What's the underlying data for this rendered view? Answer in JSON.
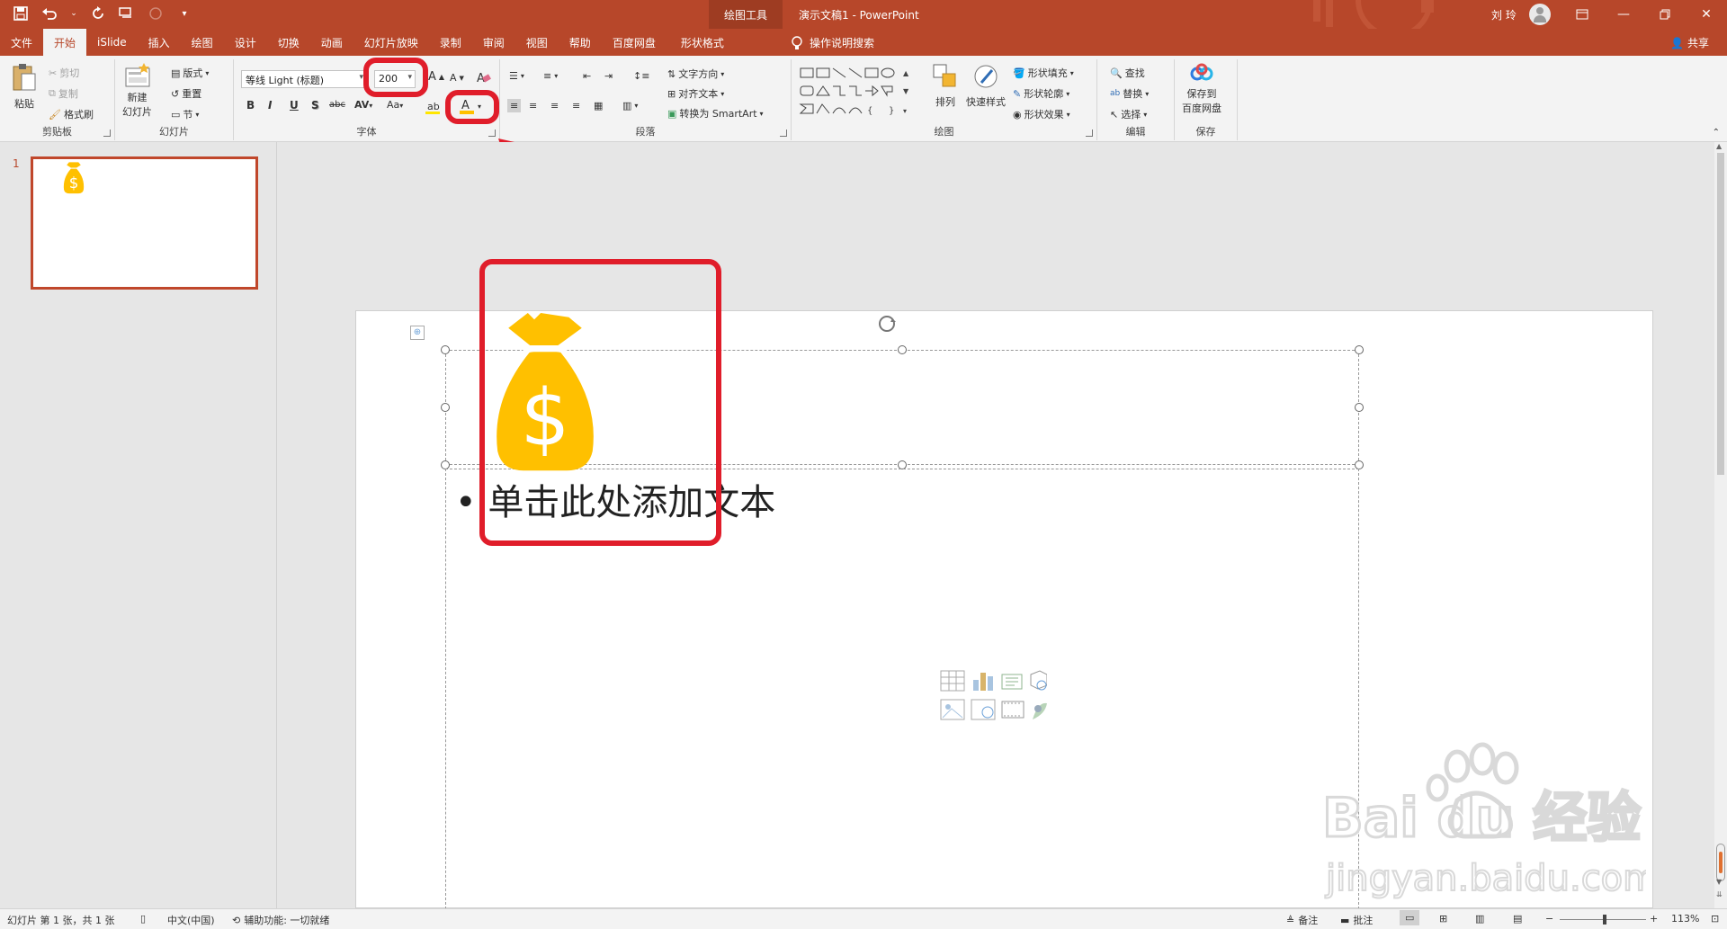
{
  "titlebar": {
    "context_group": "绘图工具",
    "doc_title": "演示文稿1  -  PowerPoint",
    "user_name": "刘 玲",
    "qat_icons": [
      "save-icon",
      "undo-icon",
      "redo-icon",
      "format-painter-icon",
      "customize-icon"
    ]
  },
  "tabs": [
    "文件",
    "开始",
    "iSlide",
    "插入",
    "绘图",
    "设计",
    "切换",
    "动画",
    "幻灯片放映",
    "录制",
    "审阅",
    "视图",
    "帮助",
    "百度网盘",
    "形状格式"
  ],
  "active_tab": "开始",
  "tell_me": "操作说明搜索",
  "share": "共享",
  "ribbon": {
    "clipboard": {
      "paste": "粘贴",
      "cut": "剪切",
      "copy": "复制",
      "format_painter": "格式刷",
      "label": "剪贴板"
    },
    "slides": {
      "new_slide_line1": "新建",
      "new_slide_line2": "幻灯片",
      "layout": "版式",
      "reset": "重置",
      "section": "节",
      "label": "幻灯片"
    },
    "font": {
      "font_name": "等线 Light (标题)",
      "font_size": "200",
      "bold": "B",
      "italic": "I",
      "underline": "U",
      "shadow": "S",
      "strike": "abc",
      "spacing": "AV",
      "case": "Aa",
      "font_color_letter": "A",
      "label": "字体"
    },
    "paragraph": {
      "text_direction": "文字方向",
      "align_text": "对齐文本",
      "smartart": "转换为 SmartArt",
      "label": "段落"
    },
    "drawing": {
      "arrange": "排列",
      "quick_styles": "快速样式",
      "shape_fill": "形状填充",
      "shape_outline": "形状轮廓",
      "shape_effects": "形状效果",
      "label": "绘图"
    },
    "editing": {
      "find": "查找",
      "replace": "替换",
      "select": "选择",
      "label": "编辑"
    },
    "save": {
      "line1": "保存到",
      "line2": "百度网盘",
      "label": "保存"
    }
  },
  "thumbnails": [
    {
      "number": "1"
    }
  ],
  "slide": {
    "body_placeholder": "单击此处添加文本",
    "title_glyph": "$"
  },
  "status": {
    "slide_info": "幻灯片 第 1 张，共 1 张",
    "language": "中文(中国)",
    "accessibility": "辅助功能: 一切就绪",
    "notes": "备注",
    "comments": "批注",
    "zoom": "113%"
  },
  "watermark": {
    "line1": "Bai du 经验",
    "line2": "jingyan.baidu.com"
  },
  "colors": {
    "accent": "#b7472a",
    "money_bag": "#ffc000",
    "highlight_ring": "#e01d2a"
  }
}
